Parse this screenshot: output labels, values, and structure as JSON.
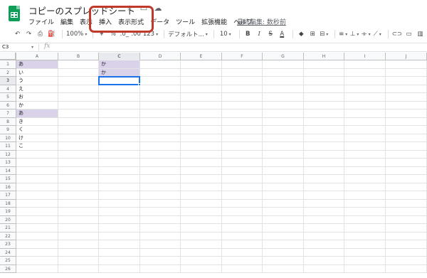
{
  "app": {
    "title": "コピーのスプレッドシート",
    "menu": [
      "ファイル",
      "編集",
      "表示",
      "挿入",
      "表示形式",
      "データ",
      "ツール",
      "拡張機能",
      "ヘルプ"
    ],
    "last_edit": "最終編集: 数秒前"
  },
  "toolbar": {
    "undo": "↶",
    "redo": "↷",
    "print": "⎙",
    "paint": "⛽",
    "zoom": "100%",
    "currency": "¥",
    "percent": "%",
    "dec_decrease": ".0_",
    "dec_increase": ".00",
    "more_formats": "123",
    "font": "デフォルト...",
    "font_size": "10",
    "bold": "B",
    "italic": "I",
    "strike": "S",
    "text_color": "A",
    "fill": "◆",
    "borders": "⊞",
    "merge": "⊟",
    "align": "≡",
    "valign": "⊥",
    "wrap": "⟛",
    "rotate": "⟋",
    "link": "⊂⊃",
    "comment": "▭",
    "chart": "▥"
  },
  "formula_bar": {
    "name_box": "C3",
    "fx": "fx",
    "value": ""
  },
  "grid": {
    "columns": [
      "A",
      "B",
      "C",
      "D",
      "E",
      "F",
      "G",
      "H",
      "I",
      "J"
    ],
    "rows": [
      "1",
      "2",
      "3",
      "4",
      "5",
      "6",
      "7",
      "8",
      "9",
      "10",
      "11",
      "12",
      "13",
      "14",
      "15",
      "16",
      "17",
      "18",
      "19",
      "20",
      "21",
      "22",
      "23",
      "24",
      "25",
      "26"
    ],
    "col_a_values": [
      "あ",
      "い",
      "う",
      "え",
      "お",
      "か",
      "あ",
      "き",
      "く",
      "け",
      "こ"
    ],
    "col_c_values": [
      "か",
      "か"
    ],
    "highlight_color": "#d9d2e9",
    "selected_cell": "C3"
  },
  "colors": {
    "accent": "#1a73e8",
    "annotation": "#c0392b",
    "sheets_green": "#0f9d58"
  }
}
